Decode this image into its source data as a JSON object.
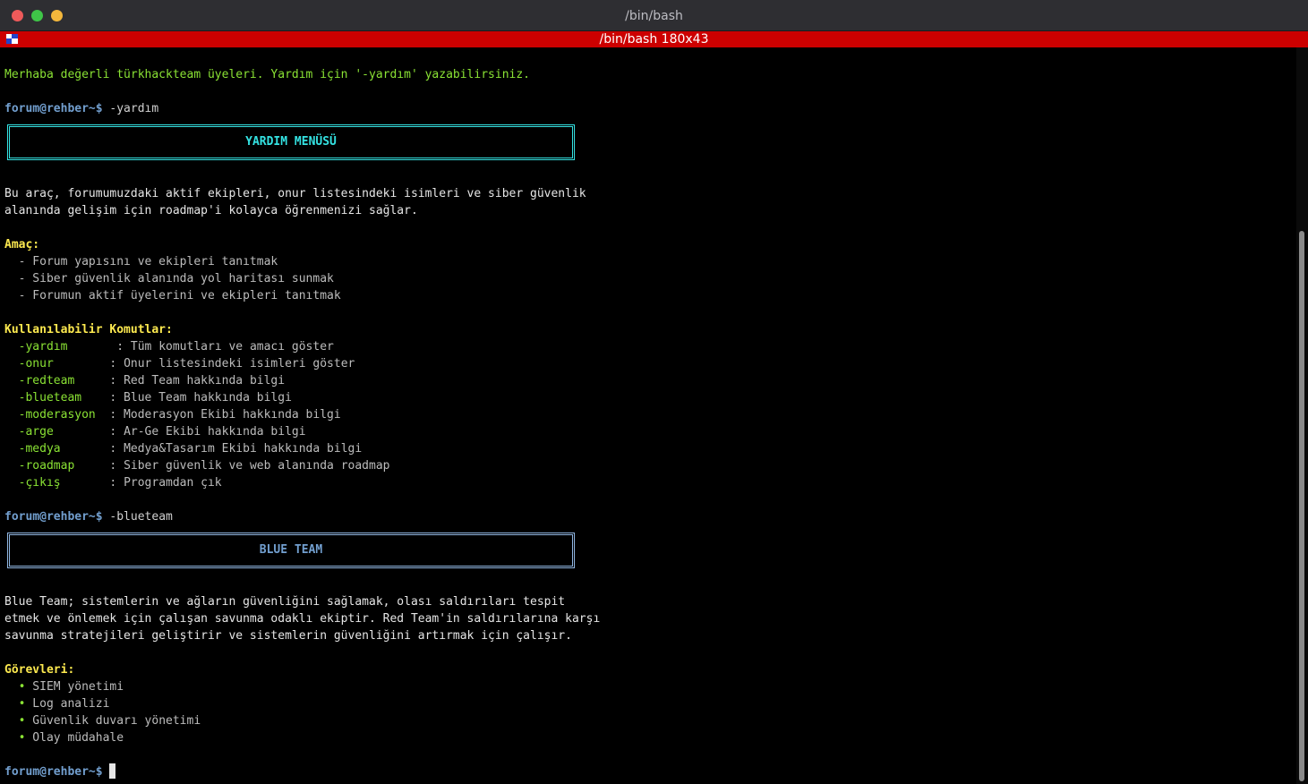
{
  "window": {
    "title": "/bin/bash",
    "tab_title": "/bin/bash 180x43"
  },
  "terminal": {
    "welcome": "Merhaba değerli türkhackteam üyeleri. Yardım için '-yardım' yazabilirsiniz.",
    "prompt": "forum@rehber~$",
    "cmd1": " -yardım",
    "help_box_title": "YARDIM MENÜSÜ",
    "intro_1": "Bu araç, forumumuzdaki aktif ekipleri, onur listesindeki isimleri ve siber güvenlik",
    "intro_2": "alanında gelişim için roadmap'i kolayca öğrenmenizi sağlar.",
    "purpose_heading": "Amaç:",
    "purpose_items": [
      "  - Forum yapısını ve ekipleri tanıtmak",
      "  - Siber güvenlik alanında yol haritası sunmak",
      "  - Forumun aktif üyelerini ve ekipleri tanıtmak"
    ],
    "commands_heading": "Kullanılabilir Komutlar:",
    "commands": [
      {
        "name": "  -yardım",
        "desc": "       : Tüm komutları ve amacı göster"
      },
      {
        "name": "  -onur",
        "desc": "        : Onur listesindeki isimleri göster"
      },
      {
        "name": "  -redteam",
        "desc": "     : Red Team hakkında bilgi"
      },
      {
        "name": "  -blueteam",
        "desc": "    : Blue Team hakkında bilgi"
      },
      {
        "name": "  -moderasyon",
        "desc": "  : Moderasyon Ekibi hakkında bilgi"
      },
      {
        "name": "  -arge",
        "desc": "        : Ar-Ge Ekibi hakkında bilgi"
      },
      {
        "name": "  -medya",
        "desc": "       : Medya&Tasarım Ekibi hakkında bilgi"
      },
      {
        "name": "  -roadmap",
        "desc": "     : Siber güvenlik ve web alanında roadmap"
      },
      {
        "name": "  -çıkış",
        "desc": "       : Programdan çık"
      }
    ],
    "cmd2": " -blueteam",
    "blue_box_title": "BLUE TEAM",
    "blue_1": "Blue Team; sistemlerin ve ağların güvenliğini sağlamak, olası saldırıları tespit",
    "blue_2": "etmek ve önlemek için çalışan savunma odaklı ekiptir. Red Team'in saldırılarına karşı",
    "blue_3": "savunma stratejileri geliştirir ve sistemlerin güvenliğini artırmak için çalışır.",
    "tasks_heading": "Görevleri:",
    "tasks": [
      {
        "bullet": "  •",
        "text": " SIEM yönetimi"
      },
      {
        "bullet": "  •",
        "text": " Log analizi"
      },
      {
        "bullet": "  •",
        "text": " Güvenlik duvarı yönetimi"
      },
      {
        "bullet": "  •",
        "text": " Olay müdahale"
      }
    ]
  },
  "colors": {
    "tab_bar": "#cc0000",
    "prompt": "#729fcf",
    "green": "#8ae234",
    "yellow": "#fce94f",
    "cyan": "#34e2e2"
  }
}
